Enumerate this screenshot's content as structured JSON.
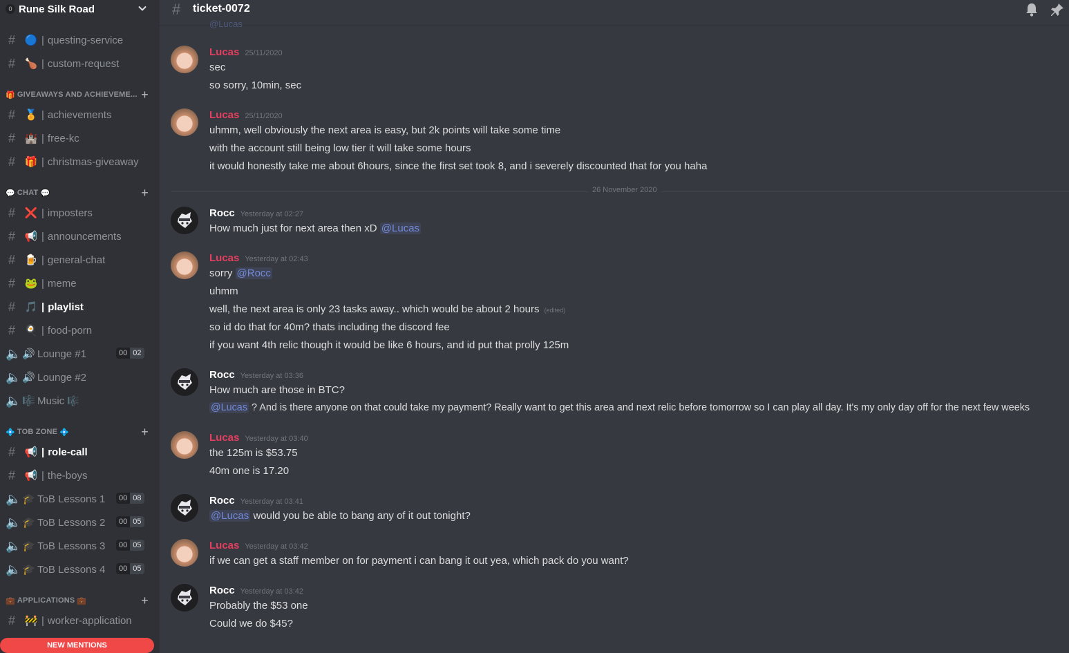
{
  "server": {
    "badge": "0",
    "name": "Rune Silk Road"
  },
  "channel": {
    "title": "ticket-0072"
  },
  "sidebar": {
    "top_channels": [
      {
        "emoji": "🔵",
        "name": "questing-service"
      },
      {
        "emoji": "🍗",
        "name": "custom-request"
      }
    ],
    "cat_giveaways": {
      "icon": "🎁",
      "label": "GIVEAWAYS AND ACHIEVEME..."
    },
    "giveaway_channels": [
      {
        "emoji": "🏅",
        "name": "achievements"
      },
      {
        "emoji": "🏰",
        "name": "free-kc"
      },
      {
        "emoji": "🎁",
        "name": "christmas-giveaway"
      }
    ],
    "cat_chat": {
      "icon": "💬",
      "label": "CHAT",
      "icon2": "💬"
    },
    "chat_channels": [
      {
        "emoji": "❌",
        "name": "imposters"
      },
      {
        "emoji": "📢",
        "name": "announcements"
      },
      {
        "emoji": "🍺",
        "name": "general-chat"
      },
      {
        "emoji": "🐸",
        "name": "meme"
      },
      {
        "emoji": "🎵",
        "name": "playlist"
      },
      {
        "emoji": "🍳",
        "name": "food-porn"
      }
    ],
    "voice_channels": [
      {
        "emoji": "🔊",
        "name": "Lounge #1",
        "count_a": "00",
        "count_b": "02"
      },
      {
        "emoji": "🔊",
        "name": "Lounge #2"
      },
      {
        "emoji": "🎼",
        "name": "Music",
        "suffix": "🎼"
      }
    ],
    "cat_tob": {
      "icon": "💠",
      "label": "TOB ZONE",
      "icon2": "💠"
    },
    "tob_channels": [
      {
        "emoji": "📢",
        "name": "role-call"
      },
      {
        "emoji": "📢",
        "name": "the-boys"
      }
    ],
    "tob_voice": [
      {
        "emoji": "🎓",
        "name": "ToB Lessons 1",
        "count_a": "00",
        "count_b": "08"
      },
      {
        "emoji": "🎓",
        "name": "ToB Lessons 2",
        "count_a": "00",
        "count_b": "05"
      },
      {
        "emoji": "🎓",
        "name": "ToB Lessons 3",
        "count_a": "00",
        "count_b": "05"
      },
      {
        "emoji": "🎓",
        "name": "ToB Lessons 4",
        "count_a": "00",
        "count_b": "05"
      }
    ],
    "cat_apps": {
      "icon": "💼",
      "label": "APPLICATIONS",
      "icon2": "💼"
    },
    "app_channels": [
      {
        "emoji": "🚧",
        "name": "worker-application"
      }
    ],
    "new_mentions": "NEW MENTIONS"
  },
  "messages": [
    {
      "author": "Lucas",
      "time": "25/11/2020",
      "lines": [
        "sec",
        "so sorry, 10min, sec"
      ]
    },
    {
      "author": "Lucas",
      "time": "25/11/2020",
      "lines": [
        "uhmm, well obviously the next area is easy, but 2k points will take some time",
        "with the account still being low tier it will take some hours",
        "it would honestly take me about 6hours, since the first set took 8, and i severely discounted that for you haha"
      ]
    },
    {
      "author": "Rocc",
      "time": "Yesterday at 02:27",
      "l1_text": "How much just for next area then xD",
      "l1_mention": "@Lucas"
    },
    {
      "author": "Lucas",
      "time": "Yesterday at 02:43",
      "l1_text": "sorry",
      "l1_mention": "@Rocc",
      "l2": "uhmm",
      "l3": "well, the next area is only 23 tasks away.. which would be about 2 hours",
      "l3_edited": "(edited)",
      "l4": "so id do that for 40m? thats including the discord fee",
      "l5": "if you want 4th relic though it would be like 6 hours, and id put that prolly 125m"
    },
    {
      "author": "Rocc",
      "time": "Yesterday at 03:36",
      "l1": "How much are those in BTC?",
      "l2_mention": "@Lucas",
      "l2_text": "? And is there anyone on that could take my payment? Really want to get this area and next relic before tomorrow so I can play all day. It's my only day off for the next few weeks"
    },
    {
      "author": "Lucas",
      "time": "Yesterday at 03:40",
      "lines": [
        "the 125m is $53.75",
        "40m one is 17.20"
      ]
    },
    {
      "author": "Rocc",
      "time": "Yesterday at 03:41",
      "l1_mention": "@Lucas",
      "l1_text": "would you be able to bang any of it out tonight?"
    },
    {
      "author": "Lucas",
      "time": "Yesterday at 03:42",
      "l1": "if we can get a staff member on for payment i can bang it out yea, which pack do you want?"
    },
    {
      "author": "Rocc",
      "time": "Yesterday at 03:42",
      "lines": [
        "Probably the $53 one",
        "Could we do $45?"
      ]
    }
  ],
  "divider": "26 November 2020",
  "colors": {
    "lucas": "#e63e60",
    "rocc": "#ffffff",
    "mention": "#7289da",
    "accent_red": "#f04747"
  },
  "icons": {
    "bell": "bell-icon",
    "pin": "pin-icon",
    "hash": "hash-icon",
    "speaker": "speaker-icon"
  }
}
